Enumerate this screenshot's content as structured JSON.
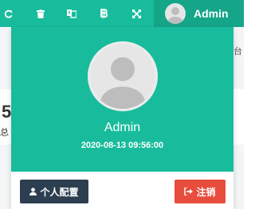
{
  "topbar": {
    "icons": [
      "refresh-icon",
      "trash-icon",
      "translate-icon",
      "bitcoin-icon",
      "fullscreen-icon"
    ],
    "username": "Admin",
    "accent_color": "#18bc9c",
    "active_color": "#15a589"
  },
  "background": {
    "number_partial": "5",
    "text_partial_a": "总",
    "text_partial_b": "台"
  },
  "dropdown": {
    "fullname": "Admin",
    "login_time": "2020-08-13 09:56:00",
    "profile_button": "个人配置",
    "logout_button": "注销",
    "profile_color": "#2c3e50",
    "logout_color": "#e74c3c"
  }
}
